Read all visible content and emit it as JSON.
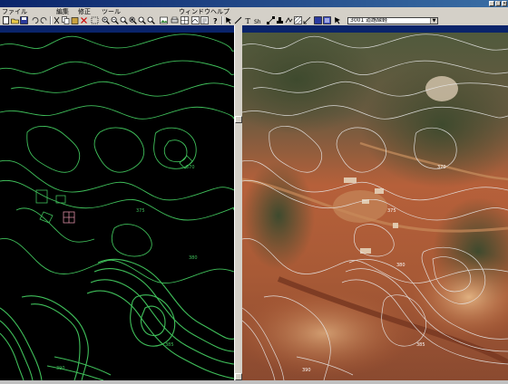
{
  "window": {
    "title": "",
    "left_caption": "",
    "right_caption": ""
  },
  "menu": {
    "items": [
      "ファイル",
      "編集",
      "修正",
      "ツール",
      "ウィンドウ",
      "ヘルプ"
    ]
  },
  "toolbar": {
    "layer_select_value": "3001   道路縁軽"
  },
  "contour_labels": [
    "370",
    "375",
    "380",
    "385",
    "390"
  ],
  "colors": {
    "contour_green": "#3fbf5a",
    "aerial_earth": "#b6603a",
    "aerial_vegetation": "#4e5a3c",
    "contour_white": "#e8e8e8"
  }
}
